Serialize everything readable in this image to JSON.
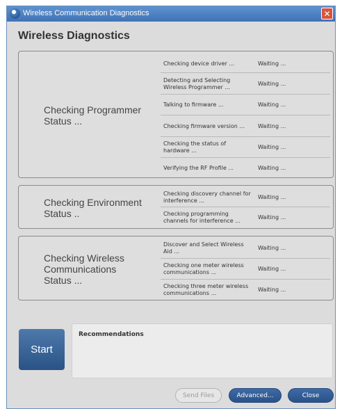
{
  "window": {
    "title": "Wireless Communication Diagnostics",
    "close_glyph": "✕"
  },
  "heading": "Wireless Diagnostics",
  "groups": [
    {
      "label_lines": [
        "Checking Programmer",
        "Status ..."
      ],
      "rows": [
        {
          "label": "Checking device driver ...",
          "status": "Waiting ..."
        },
        {
          "label": "Detecting and Selecting Wireless Programmer ...",
          "status": "Waiting ..."
        },
        {
          "label": "Talking to firmware ...",
          "status": "Waiting ..."
        },
        {
          "label": "Checking firmware version ...",
          "status": "Waiting ..."
        },
        {
          "label": "Checking the status of hardware ...",
          "status": "Waiting ..."
        },
        {
          "label": "Verifying the RF Profile ...",
          "status": "Waiting ..."
        }
      ]
    },
    {
      "label_lines": [
        "Checking Environment",
        "Status .."
      ],
      "rows": [
        {
          "label": "Checking discovery channel for interference ...",
          "status": "Waiting ..."
        },
        {
          "label": "Checking programming channels for interference ...",
          "status": "Waiting ..."
        }
      ]
    },
    {
      "label_lines": [
        "Checking Wireless",
        "Communications",
        "Status ..."
      ],
      "rows": [
        {
          "label": "Discover and Select Wireless Aid ...",
          "status": "Waiting ..."
        },
        {
          "label": "Checking one meter wireless communications ...",
          "status": "Waiting ..."
        },
        {
          "label": "Checking three meter wireless communications ...",
          "status": "Waiting ..."
        }
      ]
    }
  ],
  "start_button": "Start",
  "recommendations": {
    "title": "Recommendations"
  },
  "footer": {
    "send_files": "Send Files",
    "advanced": "Advanced...",
    "close": "Close"
  },
  "colors": {
    "titlebar": "#4a7fc1",
    "button_blue": "#2f5b93",
    "panel_bg": "#dcdcdc"
  },
  "icons": {
    "title_icon": "app-globe-icon",
    "close_icon": "close-icon"
  }
}
